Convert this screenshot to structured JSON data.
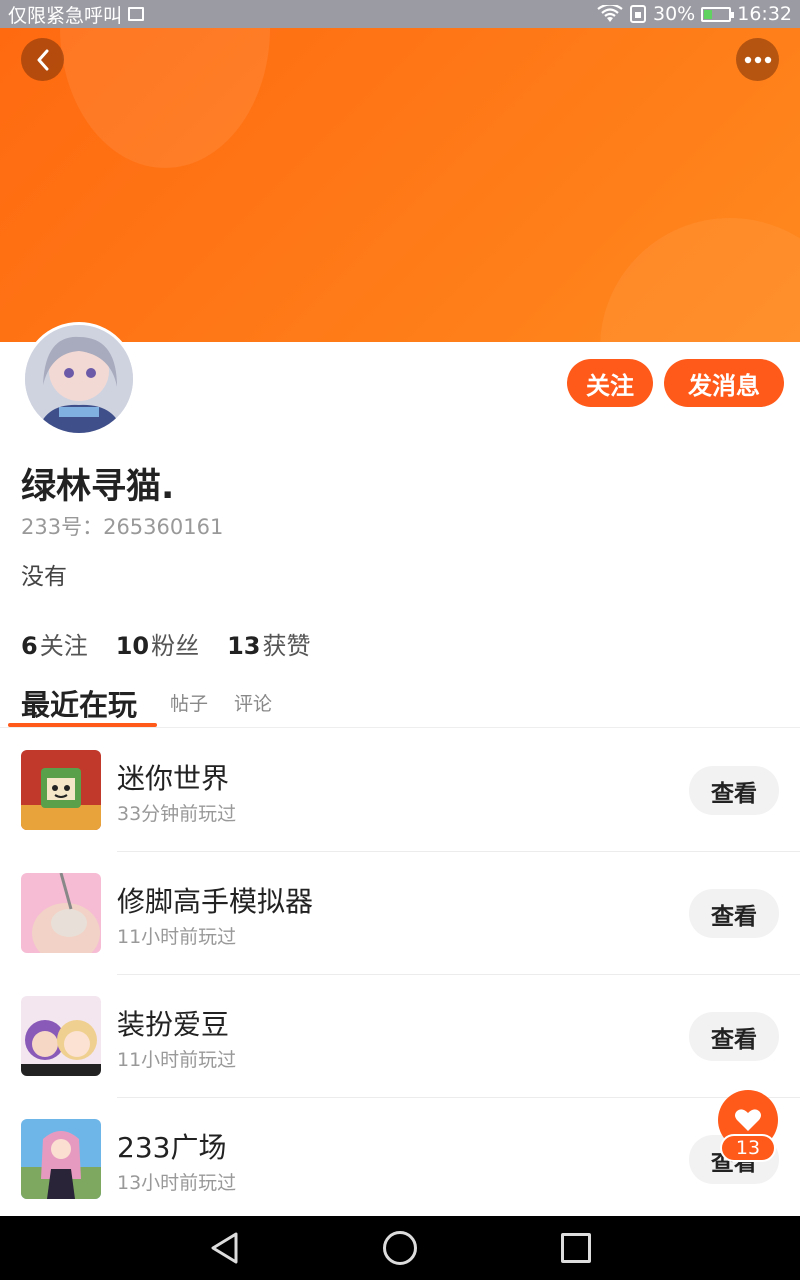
{
  "statusbar": {
    "carrier": "仅限紧急呼叫",
    "battery_percent": "30%",
    "battery_level": 0.3,
    "time": "16:32",
    "icons": [
      "image-icon",
      "wifi-icon",
      "sim-icon",
      "battery-icon"
    ]
  },
  "header": {
    "back_icon": "chevron-left-icon",
    "more_icon": "more-dots-icon"
  },
  "profile": {
    "name": "绿林寻猫.",
    "uid": "233号：265360161",
    "bio": "没有",
    "follow_label": "关注",
    "message_label": "发消息"
  },
  "stats": [
    {
      "count": "6",
      "label": "关注"
    },
    {
      "count": "10",
      "label": "粉丝"
    },
    {
      "count": "13",
      "label": "获赞"
    }
  ],
  "tabs": {
    "active": "最近在玩",
    "posts": "帖子",
    "comments": "评论"
  },
  "games": [
    {
      "title": "迷你世界",
      "time": "33分钟前玩过",
      "action": "查看"
    },
    {
      "title": "修脚高手模拟器",
      "time": "11小时前玩过",
      "action": "查看"
    },
    {
      "title": "装扮爱豆",
      "time": "11小时前玩过",
      "action": "查看"
    },
    {
      "title": "233广场",
      "time": "13小时前玩过",
      "action": "查看"
    }
  ],
  "like_fab": {
    "count": "13"
  },
  "colors": {
    "accent": "#ff5a1a",
    "banner_start": "#ff6a10",
    "banner_end": "#ff8a1e"
  }
}
